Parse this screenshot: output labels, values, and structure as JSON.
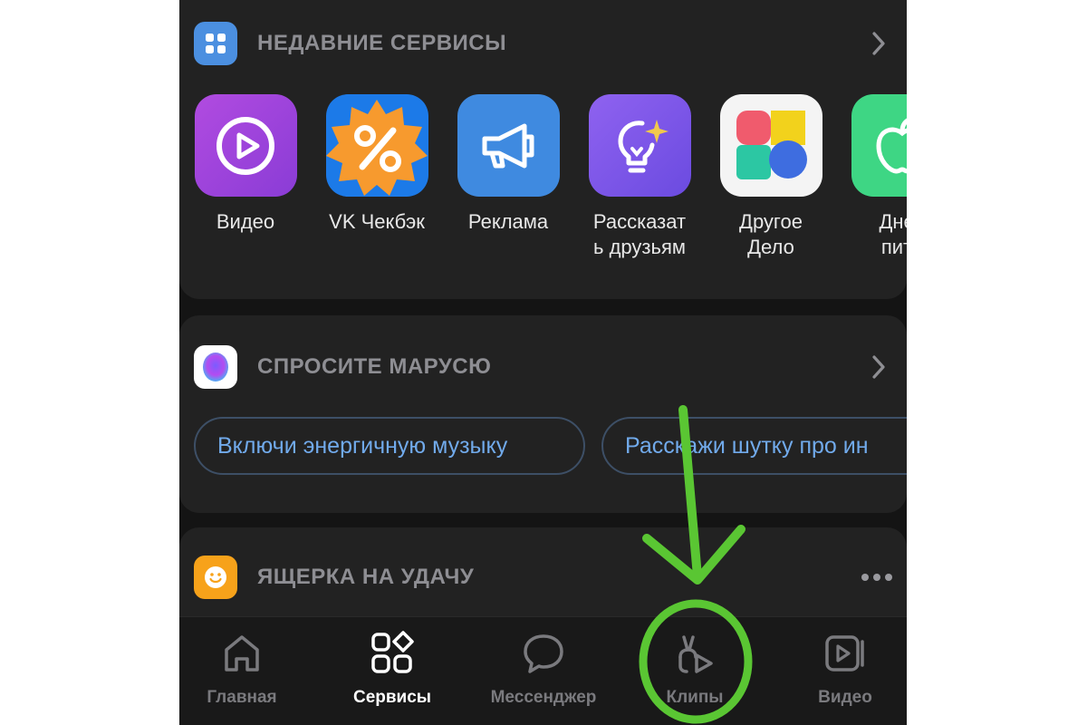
{
  "recent_services": {
    "title": "НЕДАВНИЕ СЕРВИСЫ",
    "apps": [
      {
        "label": "Видео",
        "icon": "play-circle-icon"
      },
      {
        "label": "VK Чекбэк",
        "icon": "percent-badge-icon"
      },
      {
        "label": "Реклама",
        "icon": "megaphone-icon"
      },
      {
        "label": "Рассказат\nь друзьям",
        "icon": "lightbulb-sparkle-icon"
      },
      {
        "label": "Другое\nДело",
        "icon": "colored-shapes-icon"
      },
      {
        "label": "Днев\nпита",
        "icon": "apple-icon"
      }
    ]
  },
  "marusia": {
    "title": "СПРОСИТЕ МАРУСЮ",
    "suggestions": [
      "Включи энергичную музыку",
      "Расскажи шутку про ин"
    ]
  },
  "lizard": {
    "title": "ЯЩЕРКА НА УДАЧУ"
  },
  "tabbar": {
    "tabs": [
      {
        "label": "Главная",
        "icon": "home-icon",
        "active": false
      },
      {
        "label": "Сервисы",
        "icon": "services-grid-icon",
        "active": true
      },
      {
        "label": "Мессенджер",
        "icon": "chat-bubble-icon",
        "active": false
      },
      {
        "label": "Клипы",
        "icon": "clips-icon",
        "active": false
      },
      {
        "label": "Видео",
        "icon": "video-icon",
        "active": false
      }
    ]
  },
  "annotation": {
    "arrow_color": "#5ac633",
    "target": "Клипы"
  },
  "colors": {
    "background": "#141414",
    "card": "#222222",
    "accent_blue": "#71aaeb",
    "muted_text": "#8e8e93"
  }
}
